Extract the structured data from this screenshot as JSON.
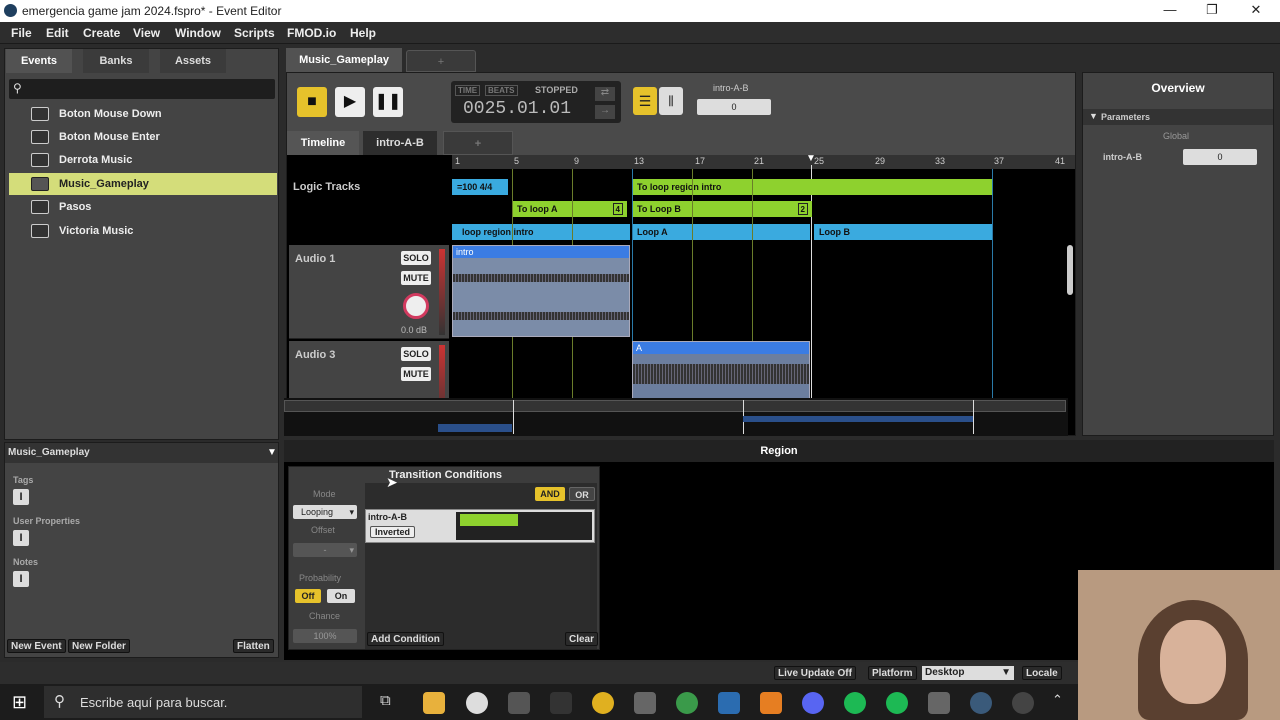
{
  "window": {
    "title": "emergencia game jam 2024.fspro* - Event Editor",
    "controls": [
      "—",
      "❐",
      "✕"
    ]
  },
  "menu": [
    "File",
    "Edit",
    "Create",
    "View",
    "Window",
    "Scripts",
    "FMOD.io",
    "Help"
  ],
  "left": {
    "tabs": [
      "Events",
      "Banks",
      "Assets"
    ],
    "events": [
      "Boton Mouse Down",
      "Boton Mouse Enter",
      "Derrota Music",
      "Music_Gameplay",
      "Pasos",
      "Victoria Music"
    ],
    "selected": "Music_Gameplay",
    "props": {
      "header": "Music_Gameplay",
      "tags": "Tags",
      "user_properties": "User Properties",
      "notes": "Notes"
    },
    "buttons": {
      "new_event": "New Event",
      "new_folder": "New Folder",
      "flatten": "Flatten"
    }
  },
  "editor": {
    "doc_tab": "Music_Gameplay",
    "add_tab": "+",
    "transport": {
      "time_label": "TIME",
      "beats_label": "BEATS",
      "state": "STOPPED",
      "position": "0025.01.01"
    },
    "param_tab_label": "intro-A-B",
    "param_value": "0",
    "tabs": [
      "Timeline",
      "intro-A-B",
      "+"
    ],
    "logic_label": "Logic Tracks",
    "ruler": [
      "1",
      "5",
      "9",
      "13",
      "17",
      "21",
      "25",
      "29",
      "33",
      "37",
      "41"
    ],
    "tempo": "=100 4/4",
    "regions": {
      "to_loop_intro": "To loop region intro",
      "to_loop_a": "To loop A",
      "to_loop_a_n": "4",
      "to_loop_b": "To Loop B",
      "to_loop_b_n": "2",
      "loop_intro": "loop region intro",
      "loop_a": "Loop A",
      "loop_b": "Loop B"
    },
    "tracks": [
      {
        "name": "Audio 1",
        "solo": "SOLO",
        "mute": "MUTE",
        "db": "0.0 dB",
        "clip": "intro"
      },
      {
        "name": "Audio 3",
        "solo": "SOLO",
        "mute": "MUTE",
        "clip": "A"
      }
    ]
  },
  "overview": {
    "title": "Overview",
    "parameters": "Parameters",
    "global": "Global",
    "param": "intro-A-B",
    "value": "0"
  },
  "region": {
    "title": "Region",
    "conditions_title": "Transition Conditions",
    "mode_label": "Mode",
    "mode_value": "Looping",
    "offset_label": "Offset",
    "offset_value": "-",
    "probability_label": "Probability",
    "off": "Off",
    "on": "On",
    "chance_label": "Chance",
    "chance_value": "100%",
    "and": "AND",
    "or": "OR",
    "param": "intro-A-B",
    "inverted": "Inverted",
    "add_condition": "Add Condition",
    "clear": "Clear"
  },
  "status": {
    "live_update": "Live Update Off",
    "platform_label": "Platform",
    "platform": "Desktop",
    "locale": "Locale"
  },
  "taskbar": {
    "search_placeholder": "Escribe aquí para buscar."
  }
}
